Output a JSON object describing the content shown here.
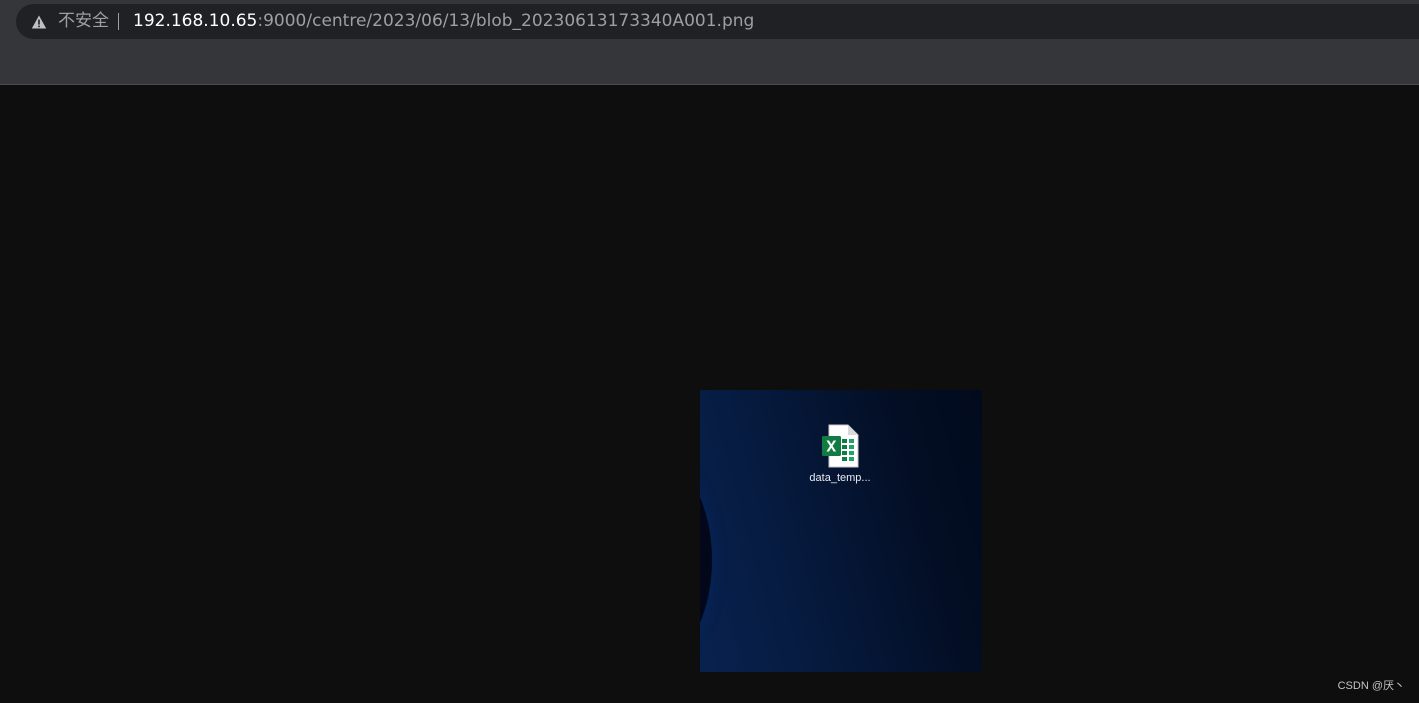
{
  "browser": {
    "security_label": "不安全",
    "url_host": "192.168.10.65",
    "url_path": ":9000/centre/2023/06/13/blob_20230613173340A001.png"
  },
  "image": {
    "desktop_file": {
      "icon": "excel-file-icon",
      "label": "data_temp..."
    }
  },
  "watermark": "CSDN @厌丶",
  "colors": {
    "toolbar": "#35363a",
    "omnibox": "#202124",
    "viewer_background": "#0e0e0e",
    "excel_green": "#107c41"
  }
}
